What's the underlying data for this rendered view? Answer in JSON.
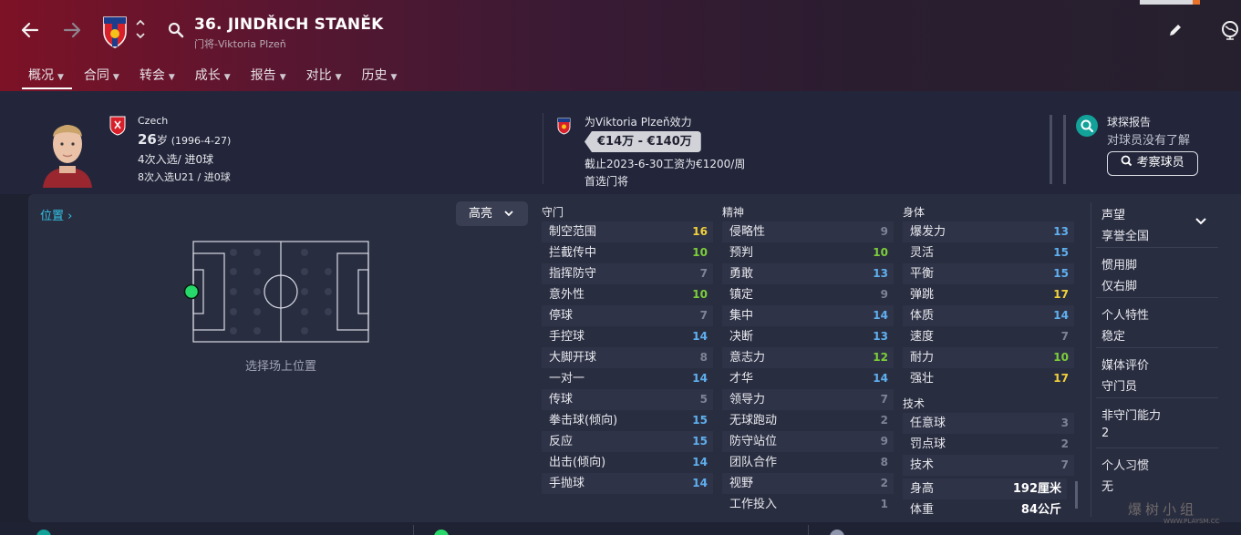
{
  "header": {
    "title": "36. JINDŘICH STANĚK",
    "subtitle": "门将-Viktoria Plzeň",
    "nav_tabs": [
      "概况",
      "合同",
      "转会",
      "成长",
      "报告",
      "对比",
      "历史"
    ]
  },
  "profile": {
    "nation": "Czech",
    "age_big": "26",
    "age_suffix": "岁",
    "birth": "(1996-4-27)",
    "caps": "4次入选/ 进0球",
    "u21_caps": "8次入选U21 / 进0球",
    "club_line": "为Viktoria Plzeň效力",
    "value_range": "€14万 - €140万",
    "contract": "截止2023-6-30工资为€1200/周",
    "role": "首选门将",
    "scout_title": "球探报告",
    "scout_desc": "对球员没有了解",
    "scout_button": "考察球员"
  },
  "position_panel": {
    "link": "位置",
    "dropdown": "高亮",
    "caption": "选择场上位置"
  },
  "attributes": {
    "goalkeeping": {
      "title": "守门",
      "items": [
        {
          "name": "制空范围",
          "value": "16",
          "color": "#f2d13c"
        },
        {
          "name": "拦截传中",
          "value": "10",
          "color": "#7ccf3a"
        },
        {
          "name": "指挥防守",
          "value": "7",
          "color": "#7f8396"
        },
        {
          "name": "意外性",
          "value": "10",
          "color": "#7ccf3a"
        },
        {
          "name": "停球",
          "value": "7",
          "color": "#7f8396"
        },
        {
          "name": "手控球",
          "value": "14",
          "color": "#5fb0f0"
        },
        {
          "name": "大脚开球",
          "value": "8",
          "color": "#7f8396"
        },
        {
          "name": "一对一",
          "value": "14",
          "color": "#5fb0f0"
        },
        {
          "name": "传球",
          "value": "5",
          "color": "#7f8396"
        },
        {
          "name": "拳击球(倾向)",
          "value": "15",
          "color": "#5fb0f0"
        },
        {
          "name": "反应",
          "value": "15",
          "color": "#5fb0f0"
        },
        {
          "name": "出击(倾向)",
          "value": "14",
          "color": "#5fb0f0"
        },
        {
          "name": "手抛球",
          "value": "14",
          "color": "#5fb0f0"
        }
      ]
    },
    "mental": {
      "title": "精神",
      "items": [
        {
          "name": "侵略性",
          "value": "9",
          "color": "#7f8396"
        },
        {
          "name": "预判",
          "value": "10",
          "color": "#7ccf3a"
        },
        {
          "name": "勇敢",
          "value": "13",
          "color": "#5fb0f0"
        },
        {
          "name": "镇定",
          "value": "9",
          "color": "#7f8396"
        },
        {
          "name": "集中",
          "value": "14",
          "color": "#5fb0f0"
        },
        {
          "name": "决断",
          "value": "13",
          "color": "#5fb0f0"
        },
        {
          "name": "意志力",
          "value": "12",
          "color": "#7ccf3a"
        },
        {
          "name": "才华",
          "value": "14",
          "color": "#5fb0f0"
        },
        {
          "name": "领导力",
          "value": "7",
          "color": "#7f8396"
        },
        {
          "name": "无球跑动",
          "value": "2",
          "color": "#7f8396"
        },
        {
          "name": "防守站位",
          "value": "9",
          "color": "#7f8396"
        },
        {
          "name": "团队合作",
          "value": "8",
          "color": "#7f8396"
        },
        {
          "name": "视野",
          "value": "2",
          "color": "#7f8396"
        },
        {
          "name": "工作投入",
          "value": "1",
          "color": "#7f8396"
        }
      ]
    },
    "physical": {
      "title": "身体",
      "items": [
        {
          "name": "爆发力",
          "value": "13",
          "color": "#5fb0f0"
        },
        {
          "name": "灵活",
          "value": "15",
          "color": "#5fb0f0"
        },
        {
          "name": "平衡",
          "value": "15",
          "color": "#5fb0f0"
        },
        {
          "name": "弹跳",
          "value": "17",
          "color": "#f2d13c"
        },
        {
          "name": "体质",
          "value": "14",
          "color": "#5fb0f0"
        },
        {
          "name": "速度",
          "value": "7",
          "color": "#7f8396"
        },
        {
          "name": "耐力",
          "value": "10",
          "color": "#7ccf3a"
        },
        {
          "name": "强壮",
          "value": "17",
          "color": "#f2d13c"
        }
      ]
    },
    "technical": {
      "title": "技术",
      "items": [
        {
          "name": "任意球",
          "value": "3",
          "color": "#7f8396"
        },
        {
          "name": "罚点球",
          "value": "2",
          "color": "#7f8396"
        },
        {
          "name": "技术",
          "value": "7",
          "color": "#7f8396"
        }
      ]
    },
    "body": [
      {
        "name": "身高",
        "value": "192厘米"
      },
      {
        "name": "体重",
        "value": "84公斤"
      }
    ]
  },
  "info": [
    {
      "label": "声望",
      "value": "享誉全国"
    },
    {
      "label": "惯用脚",
      "value": "仅右脚"
    },
    {
      "label": "个人特性",
      "value": "稳定"
    },
    {
      "label": "媒体评价",
      "value": "守门员"
    },
    {
      "label": "非守门能力",
      "value": "2"
    },
    {
      "label": "个人习惯",
      "value": "无"
    }
  ],
  "watermark": {
    "main": "爆树小组",
    "sub": "WWW.PLAYSM.CC"
  },
  "colors": {
    "accent": "#32c3e6",
    "header": "#7d1226",
    "panel": "#292d40"
  }
}
